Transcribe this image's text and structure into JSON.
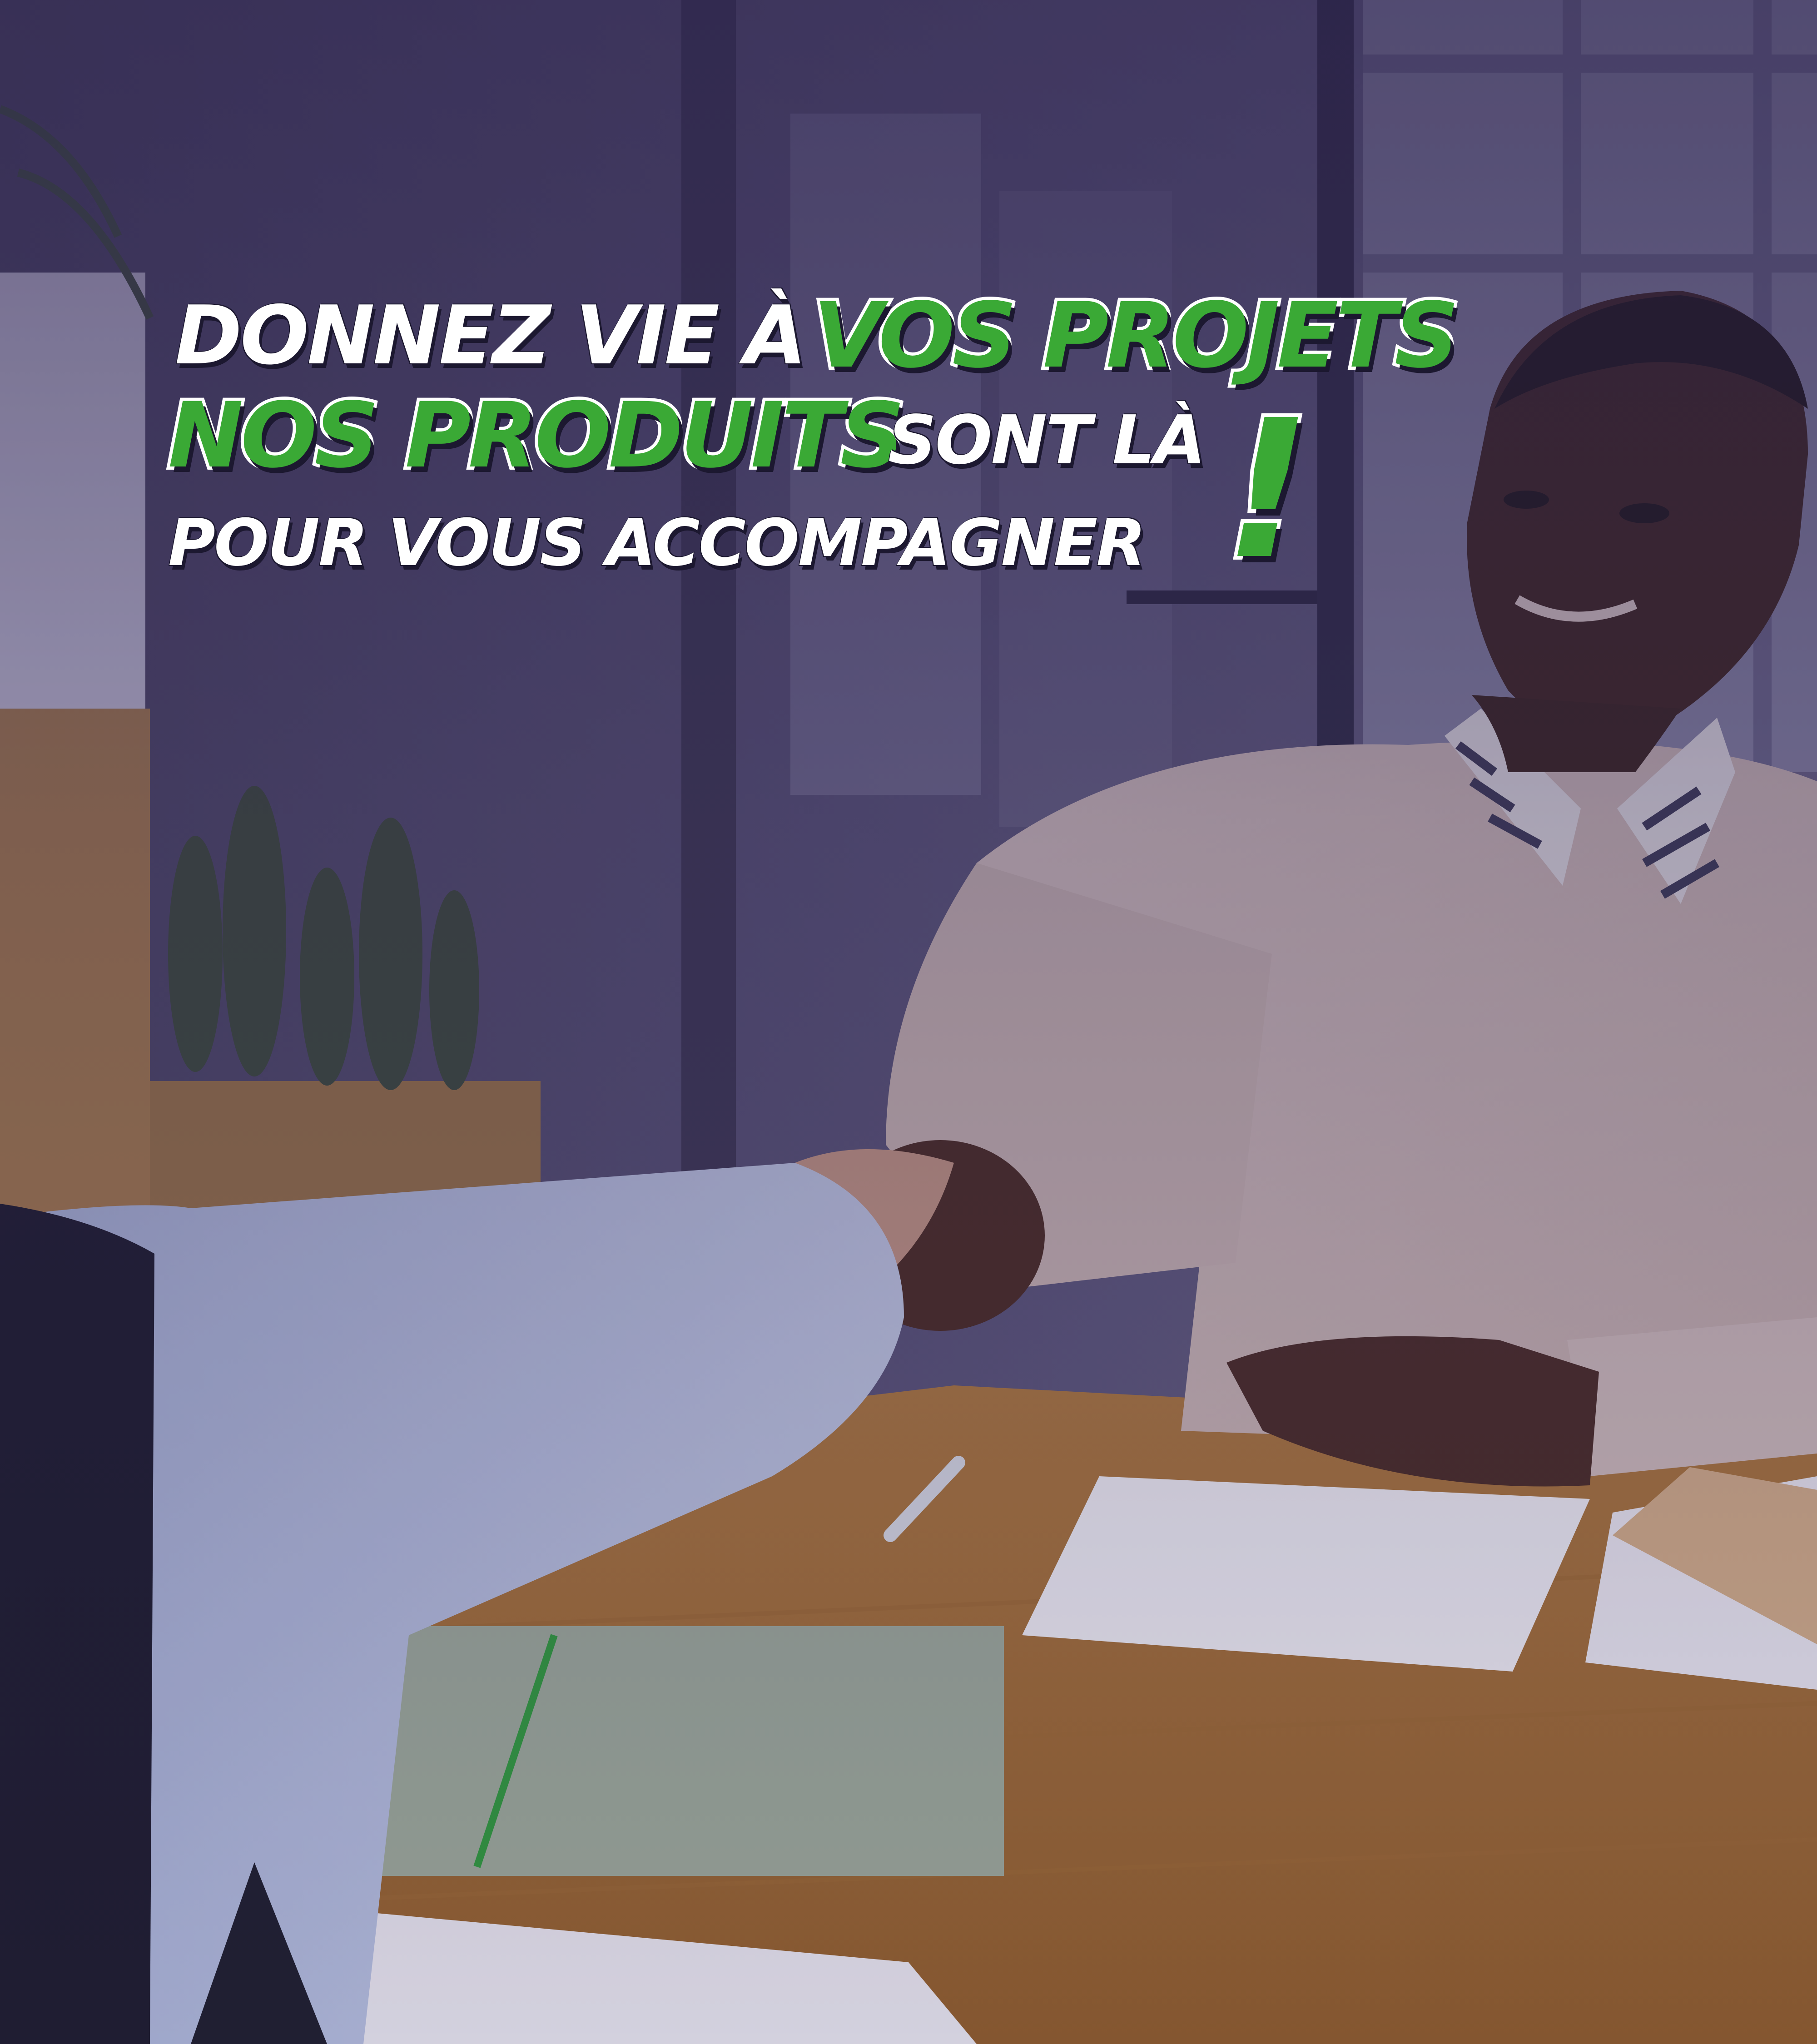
{
  "headline": {
    "line1_white": "DONNEZ VIE À",
    "line1_green": "VOS PROJETS",
    "line2_green": "NOS PRODUITS",
    "line2_white": "SONT LÀ",
    "line3_white": "POUR VOUS ACCOMPAGNER",
    "exclamation": "!"
  },
  "colors": {
    "accent_green": "#3aa935",
    "headline_white": "#ffffff",
    "overlay_tint": "#3a2f6b"
  }
}
